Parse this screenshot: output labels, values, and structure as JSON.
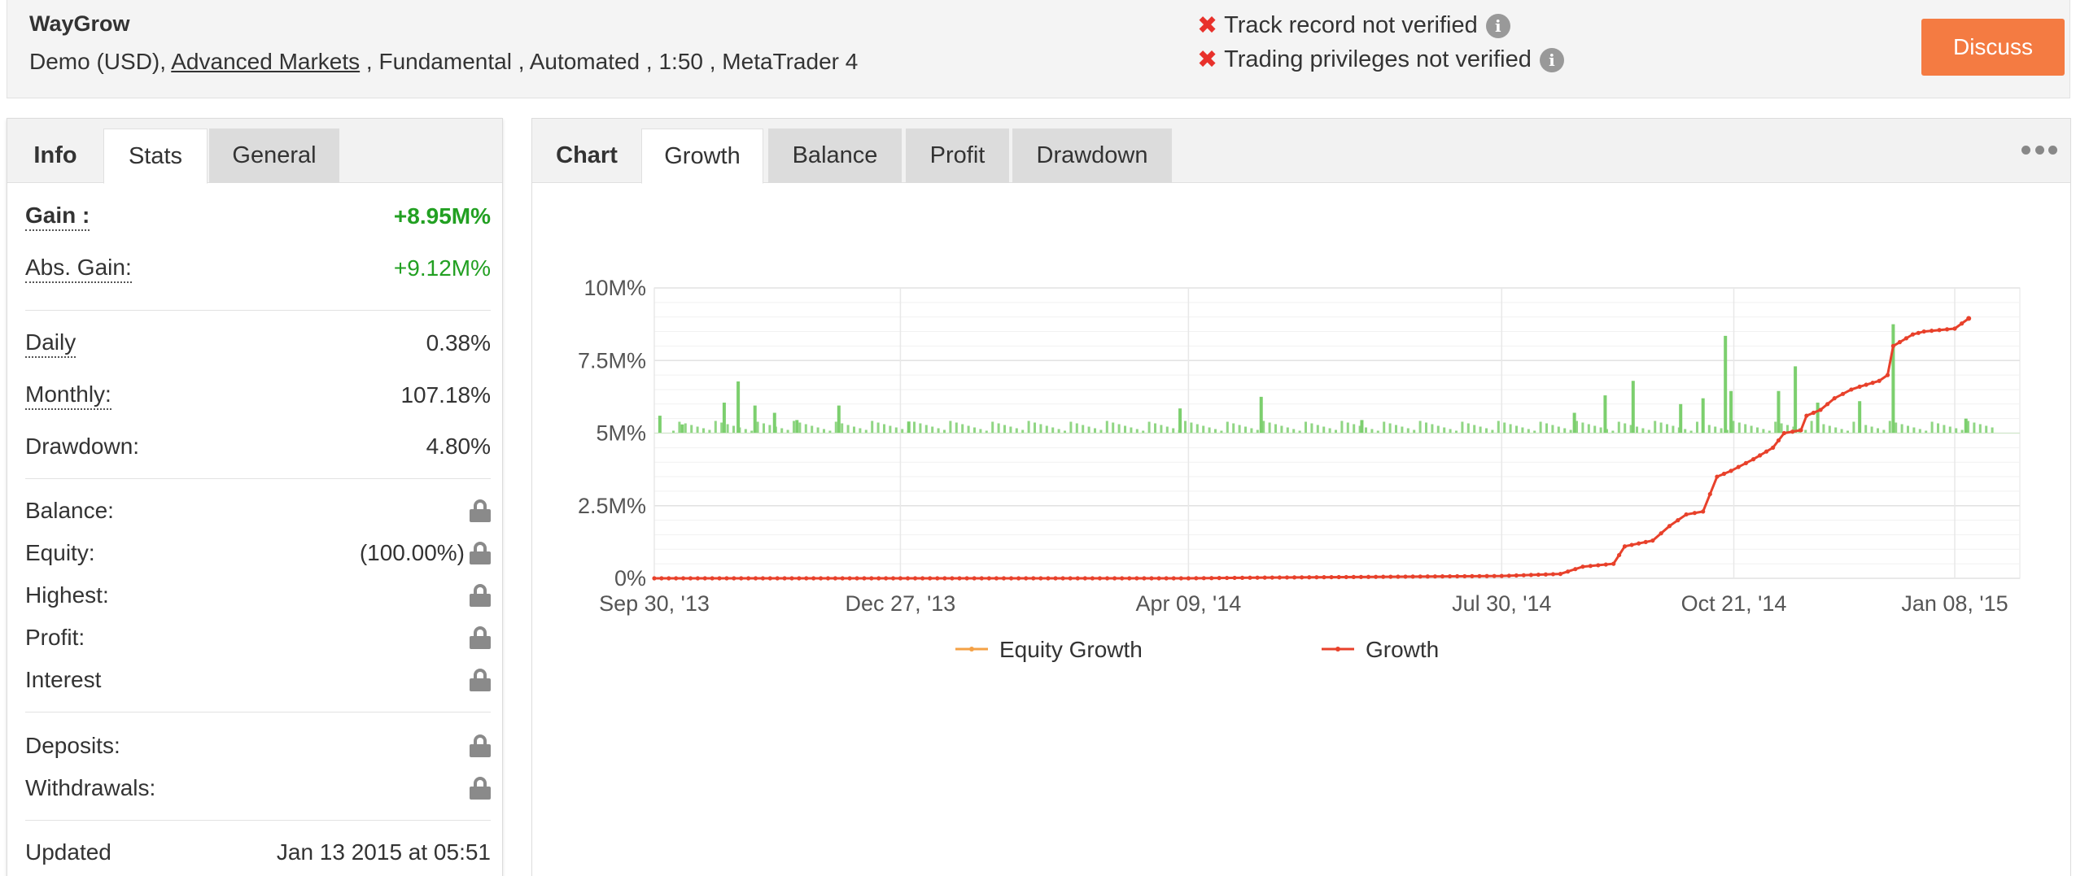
{
  "header": {
    "title": "WayGrow",
    "desc_prefix": "Demo (USD), ",
    "broker": "Advanced Markets",
    "desc_suffix": " , Fundamental , Automated , 1:50 , MetaTrader 4",
    "verif_track": "Track record not verified",
    "verif_trading": "Trading privileges not verified",
    "discuss_label": "Discuss"
  },
  "left_tabs": {
    "info": "Info",
    "stats": "Stats",
    "general": "General"
  },
  "stats": {
    "gain_label": "Gain :",
    "gain_value": "+8.95M%",
    "abs_gain_label": "Abs. Gain:",
    "abs_gain_value": "+9.12M%",
    "daily_label": "Daily",
    "daily_value": "0.38%",
    "monthly_label": "Monthly:",
    "monthly_value": "107.18%",
    "drawdown_label": "Drawdown:",
    "drawdown_value": "4.80%",
    "balance_label": "Balance:",
    "equity_label": "Equity:",
    "equity_value": "(100.00%)",
    "highest_label": "Highest:",
    "profit_label": "Profit:",
    "interest_label": "Interest",
    "deposits_label": "Deposits:",
    "withdrawals_label": "Withdrawals:",
    "updated_label": "Updated",
    "updated_value": "Jan 13 2015 at 05:51"
  },
  "chart_tabs": {
    "chart": "Chart",
    "growth": "Growth",
    "balance": "Balance",
    "profit": "Profit",
    "drawdown": "Drawdown"
  },
  "colors": {
    "accent": "#f47b42",
    "growth_line": "#e8412b",
    "equity_line": "#f4a146",
    "daily_bars": "#7ccf6e",
    "negative_bars": "#e8312b"
  },
  "chart_data": {
    "type": "line",
    "ylim": [
      0,
      10000000
    ],
    "y_ticks": [
      "0%",
      "2.5M%",
      "5M%",
      "7.5M%",
      "10M%"
    ],
    "x_ticks": [
      "Sep 30, '13",
      "Dec 27, '13",
      "Apr 09, '14",
      "Jul 30, '14",
      "Oct 21, '14",
      "Jan 08, '15"
    ],
    "grid": true,
    "legend": [
      "Equity Growth",
      "Growth"
    ],
    "legend_position": "bottom",
    "series": [
      {
        "name": "Growth",
        "points": [
          [
            "Sep 30, '13",
            0
          ],
          [
            "Dec 27, '13",
            0
          ],
          [
            "Apr 09, '14",
            0
          ],
          [
            "May 01, '14",
            20000
          ],
          [
            "Jul 30, '14",
            80000
          ],
          [
            "Aug 20, '14",
            150000
          ],
          [
            "Aug 28, '14",
            400000
          ],
          [
            "Sep 08, '14",
            500000
          ],
          [
            "Sep 12, '14",
            1100000
          ],
          [
            "Sep 22, '14",
            1300000
          ],
          [
            "Sep 28, '14",
            1800000
          ],
          [
            "Oct 04, '14",
            2200000
          ],
          [
            "Oct 10, '14",
            2300000
          ],
          [
            "Oct 15, '14",
            3500000
          ],
          [
            "Oct 20, '14",
            3700000
          ],
          [
            "Oct 28, '14",
            4100000
          ],
          [
            "Nov 04, '14",
            4500000
          ],
          [
            "Nov 08, '14",
            5000000
          ],
          [
            "Nov 14, '14",
            5100000
          ],
          [
            "Nov 16, '14",
            5600000
          ],
          [
            "Nov 21, '14",
            5800000
          ],
          [
            "Nov 26, '14",
            6200000
          ],
          [
            "Dec 02, '14",
            6500000
          ],
          [
            "Dec 05, '14",
            6600000
          ],
          [
            "Dec 12, '14",
            6800000
          ],
          [
            "Dec 15, '14",
            7000000
          ],
          [
            "Dec 17, '14",
            8000000
          ],
          [
            "Dec 24, '14",
            8400000
          ],
          [
            "Dec 28, '14",
            8500000
          ],
          [
            "Jan 08, '15",
            8600000
          ],
          [
            "Jan 13, '15",
            8950000
          ]
        ]
      }
    ],
    "daily_bars": [
      [
        "Oct 02, '13",
        600000
      ],
      [
        "Oct 10, '13",
        300000
      ],
      [
        "Oct 25, '13",
        1050000
      ],
      [
        "Oct 30, '13",
        1780000
      ],
      [
        "Nov 05, '13",
        950000
      ],
      [
        "Nov 12, '13",
        700000
      ],
      [
        "Nov 20, '13",
        450000
      ],
      [
        "Dec 05, '13",
        950000
      ],
      [
        "Dec 30, '13",
        400000
      ],
      [
        "Apr 06, '14",
        850000
      ],
      [
        "May 05, '14",
        1250000
      ],
      [
        "Jun 10, '14",
        450000
      ],
      [
        "Aug 25, '14",
        700000
      ],
      [
        "Sep 05, '14",
        1300000
      ],
      [
        "Sep 15, '14",
        1800000
      ],
      [
        "Oct 02, '14",
        1000000
      ],
      [
        "Oct 10, '14",
        1200000
      ],
      [
        "Oct 18, '14",
        3350000
      ],
      [
        "Oct 20, '14",
        1450000
      ],
      [
        "Nov 06, '14",
        1450000
      ],
      [
        "Nov 12, '14",
        2300000
      ],
      [
        "Nov 20, '14",
        1050000
      ],
      [
        "Dec 05, '14",
        1100000
      ],
      [
        "Dec 17, '14",
        3750000
      ],
      [
        "Jan 12, '15",
        500000
      ]
    ]
  }
}
